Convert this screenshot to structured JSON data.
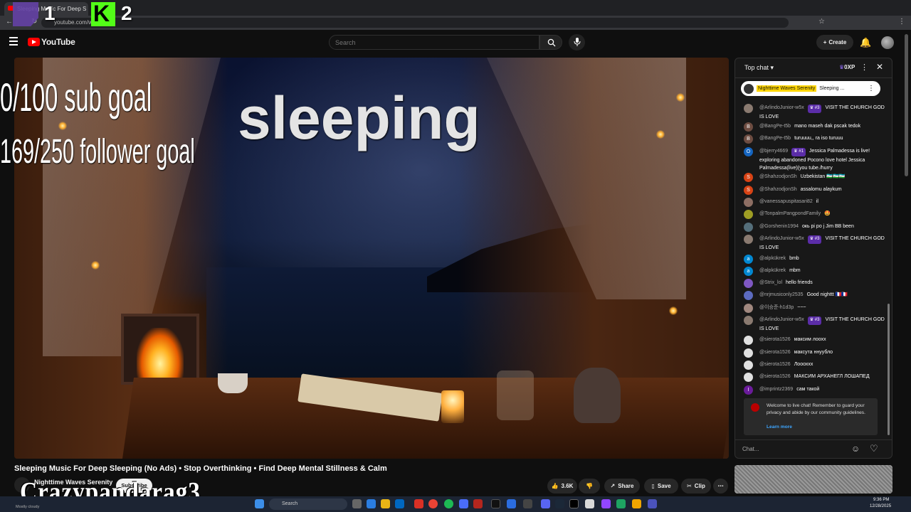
{
  "browser": {
    "tab_title": "Sleeping Music For Deep S",
    "url": "youtube.com/wat"
  },
  "overlays": {
    "platform1_number": "1",
    "platform2_letter": "K",
    "platform2_number": "2",
    "sub_goal": "0/100 sub goal",
    "follower_goal": "169/250 follower goal",
    "video_caption": "sleeping",
    "streamer_name": "Crazypandarag3"
  },
  "header": {
    "logo_text": "YouTube",
    "search_placeholder": "Search",
    "create_label": "Create"
  },
  "video": {
    "title": "Sleeping Music For Deep Sleeping (No Ads) • Stop Overthinking • Find Deep Mental Stillness & Calm",
    "channel_name": "Nighttime Waves Serenity",
    "subscribe_label": "Subscribe",
    "likes": "3.6K",
    "share_label": "Share",
    "save_label": "Save",
    "clip_label": "Clip"
  },
  "chat": {
    "header_label": "Top chat",
    "xp_label": "0XP",
    "pinned": {
      "author": "Nighttime Waves Serenity",
      "text": "Sleeping ..."
    },
    "messages": [
      {
        "author": "@ArlindoJunior-w5x",
        "badge": "#3",
        "text": "VISIT THE CHURCH GOD IS LOVE",
        "avatar_color": "#8a7a70",
        "initial": ""
      },
      {
        "author": "@BangPe-t5b",
        "badge": "",
        "text": "mano maseh dak pscak tedok",
        "avatar_color": "#6d4c41",
        "initial": "B"
      },
      {
        "author": "@BangPe-t5b",
        "badge": "",
        "text": "turuuuu,, ra iso turuuu",
        "avatar_color": "#6d4c41",
        "initial": "B"
      },
      {
        "author": "@bjerry4669",
        "badge": "#1",
        "text": "Jessica Palmadessa is live! exploring abandoned Pocono love hotel Jessica Palmadessa(live)(you tube./hurry",
        "avatar_color": "#1565c0",
        "initial": "O"
      },
      {
        "author": "@ShahzodjonSh",
        "badge": "",
        "text": "Uzbekistan 🇺🇿🇺🇿🇺🇿",
        "avatar_color": "#d84315",
        "initial": "S"
      },
      {
        "author": "@ShahzodjonSh",
        "badge": "",
        "text": "assalomu alaykum",
        "avatar_color": "#d84315",
        "initial": "S"
      },
      {
        "author": "@vanessapuspitasari82",
        "badge": "",
        "text": "il",
        "avatar_color": "#8d6e63",
        "initial": ""
      },
      {
        "author": "@TonpalmPangpondFamily",
        "badge": "",
        "text": "🤩",
        "avatar_color": "#9e9d24",
        "initial": ""
      },
      {
        "author": "@Gorshenin1994",
        "badge": "",
        "text": "окь pi po j Jim BB been",
        "avatar_color": "#546e7a",
        "initial": ""
      },
      {
        "author": "@ArlindoJunior-w5x",
        "badge": "#3",
        "text": "VISIT THE CHURCH GOD IS LOVE",
        "avatar_color": "#8a7a70",
        "initial": ""
      },
      {
        "author": "@alpkükrek",
        "badge": "",
        "text": "bmb",
        "avatar_color": "#0288d1",
        "initial": "a"
      },
      {
        "author": "@alpkükrek",
        "badge": "",
        "text": "mbm",
        "avatar_color": "#0288d1",
        "initial": "a"
      },
      {
        "author": "@Strix_lol",
        "badge": "",
        "text": "hello friends",
        "avatar_color": "#7e57c2",
        "initial": ""
      },
      {
        "author": "@nrjmusiconly2535",
        "badge": "",
        "text": "Good nighttt 🇫🇷🇫🇷",
        "avatar_color": "#5c6bc0",
        "initial": ""
      },
      {
        "author": "@이승준-h1d3p",
        "badge": "",
        "text": "~~~",
        "avatar_color": "#a1887f",
        "initial": ""
      },
      {
        "author": "@ArlindoJunior-w5x",
        "badge": "#3",
        "text": "VISIT THE CHURCH GOD IS LOVE",
        "avatar_color": "#8a7a70",
        "initial": ""
      },
      {
        "author": "@sierota1526",
        "badge": "",
        "text": "максим лоохх",
        "avatar_color": "#e0e0e0",
        "initial": ""
      },
      {
        "author": "@sierota1526",
        "badge": "",
        "text": "максута ннуубло",
        "avatar_color": "#e0e0e0",
        "initial": ""
      },
      {
        "author": "@sierota1526",
        "badge": "",
        "text": "Лоооххх",
        "avatar_color": "#e0e0e0",
        "initial": ""
      },
      {
        "author": "@sierota1526",
        "badge": "",
        "text": "МАКСИМ АРХАНЕГЛ ЛОШАПЕД",
        "avatar_color": "#e0e0e0",
        "initial": ""
      },
      {
        "author": "@imprintz2369",
        "badge": "",
        "text": "сам такой",
        "avatar_color": "#6a1b9a",
        "initial": "I"
      }
    ],
    "welcome_text": "Welcome to live chat! Remember to guard your privacy and abide by our community guidelines.",
    "learn_more": "Learn more",
    "input_placeholder": "Chat..."
  },
  "taskbar": {
    "weather": "Mostly cloudy",
    "search_label": "Search",
    "time": "9:36 PM",
    "date": "12/28/2025"
  }
}
